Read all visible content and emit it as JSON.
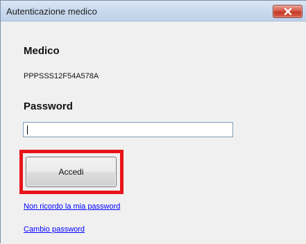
{
  "window": {
    "title": "Autenticazione medico",
    "close_icon": "close-icon"
  },
  "form": {
    "medico_label": "Medico",
    "medico_value": "PPPSSS12F54A578A",
    "password_label": "Password",
    "password_value": "",
    "submit_label": "Accedi",
    "forgot_link": "Non ricordo la mia password",
    "change_link": "Cambio password"
  },
  "colors": {
    "highlight": "#e8141a",
    "link": "#0000ff",
    "close_button": "#c43a26"
  }
}
